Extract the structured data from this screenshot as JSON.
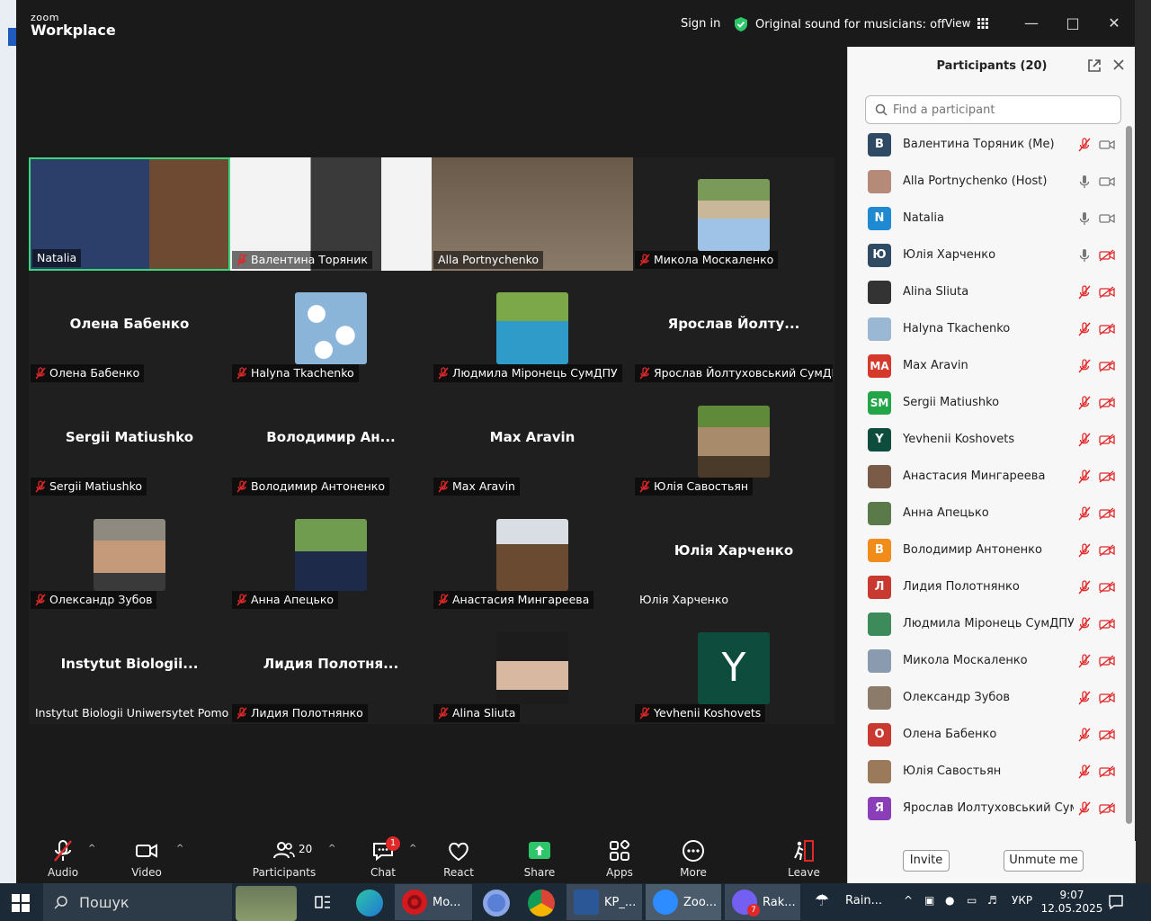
{
  "window": {
    "logo_top": "zoom",
    "logo_bottom": "Workplace",
    "sign_in": "Sign in",
    "music_status": "Original sound for musicians: off",
    "view_label": "View"
  },
  "tiles": [
    {
      "name": "Natalia",
      "kind": "video",
      "active": true,
      "muted": false
    },
    {
      "name": "Валентина Торяник",
      "kind": "video",
      "muted": true
    },
    {
      "name": "Alla Portnychenko",
      "kind": "video",
      "muted": false
    },
    {
      "name": "Микола Москаленко",
      "kind": "photo",
      "muted": true
    },
    {
      "name": "Олена Бабенко",
      "kind": "text",
      "big": "Олена Бабенко",
      "muted": true
    },
    {
      "name": "Halyna Tkachenko",
      "kind": "photo",
      "muted": true
    },
    {
      "name": "Людмила Міронець СумДПУ",
      "kind": "photo",
      "muted": true
    },
    {
      "name": "Ярослав Йолтуховський СумДП...",
      "kind": "text",
      "big": "Ярослав  Йолту...",
      "muted": true
    },
    {
      "name": "Sergii Matiushko",
      "kind": "text",
      "big": "Sergii Matiushko",
      "muted": true
    },
    {
      "name": "Володимир Антоненко",
      "kind": "text",
      "big": "Володимир  Ан...",
      "muted": true
    },
    {
      "name": "Max Aravin",
      "kind": "text",
      "big": "Max Aravin",
      "muted": true
    },
    {
      "name": "Юлія Савостьян",
      "kind": "photo",
      "muted": true
    },
    {
      "name": "Олександр Зубов",
      "kind": "photo",
      "muted": true
    },
    {
      "name": "Анна Апецько",
      "kind": "photo",
      "muted": true
    },
    {
      "name": "Анастасия Мингареева",
      "kind": "photo",
      "muted": true
    },
    {
      "name": "Юлія Харченко",
      "kind": "text",
      "big": "Юлія Харченко",
      "muted": false
    },
    {
      "name": "Instytut Biologii Uniwersytet Pomors...",
      "kind": "text",
      "big": "Instytut  Biologii...",
      "muted": false
    },
    {
      "name": "Лидия Полотнянко",
      "kind": "text",
      "big": "Лидия  Полотня...",
      "muted": true
    },
    {
      "name": "Alina Sliuta",
      "kind": "photo",
      "muted": true
    },
    {
      "name": "Yevhenii Koshovets",
      "kind": "letter",
      "letter": "Y",
      "muted": true
    }
  ],
  "toolbar": {
    "audio": "Audio",
    "video": "Video",
    "participants": "Participants",
    "participants_count": "20",
    "chat": "Chat",
    "chat_badge": "1",
    "react": "React",
    "share": "Share",
    "apps": "Apps",
    "more": "More",
    "leave": "Leave"
  },
  "panel": {
    "title": "Participants (20)",
    "search_placeholder": "Find a participant",
    "invite": "Invite",
    "unmute_me": "Unmute me",
    "participants": [
      {
        "name": "Валентина Торяник (Me)",
        "avatar": "В",
        "color": "#2f4a63",
        "mic": "muted",
        "cam": "on"
      },
      {
        "name": "Alla Portnychenko (Host)",
        "avatar": "",
        "color": "#b58a78",
        "mic": "on",
        "cam": "on"
      },
      {
        "name": "Natalia",
        "avatar": "N",
        "color": "#1f8ad1",
        "mic": "on",
        "cam": "on"
      },
      {
        "name": "Юлія Харченко",
        "avatar": "Ю",
        "color": "#2f4a63",
        "mic": "on",
        "cam": "off"
      },
      {
        "name": "Alina Sliuta",
        "avatar": "",
        "color": "#333333",
        "mic": "muted",
        "cam": "off"
      },
      {
        "name": "Halyna Tkachenko",
        "avatar": "",
        "color": "#9ab7d4",
        "mic": "muted",
        "cam": "off"
      },
      {
        "name": "Max Aravin",
        "avatar": "MA",
        "color": "#d4392c",
        "mic": "muted",
        "cam": "off"
      },
      {
        "name": "Sergii Matiushko",
        "avatar": "SM",
        "color": "#22a547",
        "mic": "muted",
        "cam": "off"
      },
      {
        "name": "Yevhenii Koshovets",
        "avatar": "Y",
        "color": "#0e4d3e",
        "mic": "muted",
        "cam": "off"
      },
      {
        "name": "Анастасия Мингареева",
        "avatar": "",
        "color": "#7a5b48",
        "mic": "muted",
        "cam": "off"
      },
      {
        "name": "Анна Апецько",
        "avatar": "",
        "color": "#5b7a4a",
        "mic": "muted",
        "cam": "off"
      },
      {
        "name": "Володимир Антоненко",
        "avatar": "В",
        "color": "#f08c1a",
        "mic": "muted",
        "cam": "off"
      },
      {
        "name": "Лидия Полотнянко",
        "avatar": "Л",
        "color": "#c83a2f",
        "mic": "muted",
        "cam": "off"
      },
      {
        "name": "Людмила Міронець СумДПУ",
        "avatar": "",
        "color": "#3d8a5a",
        "mic": "muted",
        "cam": "off"
      },
      {
        "name": "Микола Москаленко",
        "avatar": "",
        "color": "#8a9bb0",
        "mic": "muted",
        "cam": "off"
      },
      {
        "name": "Олександр Зубов",
        "avatar": "",
        "color": "#8c7a6a",
        "mic": "muted",
        "cam": "off"
      },
      {
        "name": "Олена Бабенко",
        "avatar": "О",
        "color": "#c83a2f",
        "mic": "muted",
        "cam": "off"
      },
      {
        "name": "Юлія Савостьян",
        "avatar": "",
        "color": "#9a7a5a",
        "mic": "muted",
        "cam": "off"
      },
      {
        "name": "Ярослав Йолтуховський СумД...",
        "avatar": "Я",
        "color": "#8a3fb8",
        "mic": "muted",
        "cam": "off"
      }
    ]
  },
  "taskbar": {
    "search_placeholder": "Пошук",
    "apps": [
      {
        "label": "Mo...",
        "color": "#d4191f"
      },
      {
        "label": "KP_...",
        "color": "#2b5797"
      },
      {
        "label": "Zoo...",
        "color": "#2d8cff"
      },
      {
        "label": "Rak...",
        "color": "#7360f2"
      }
    ],
    "viber_badge": "7",
    "weather": "Rain...",
    "lang": "УКР",
    "time": "9:07",
    "date": "12.05.2025"
  }
}
